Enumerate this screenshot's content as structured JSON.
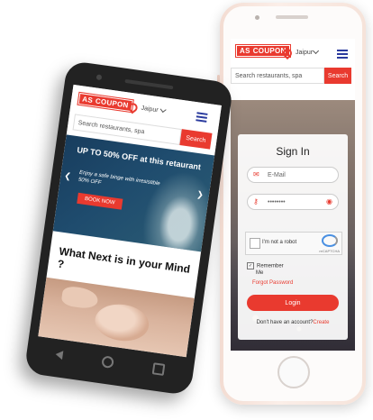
{
  "brand": {
    "logo_prefix": "AS",
    "logo_text": "COUPON",
    "accent": "#e93a2f",
    "nav_color": "#2a3b9e"
  },
  "iphone": {
    "header": {
      "city": "Jaipur",
      "search_placeholder": "Search restaurants, spa",
      "search_button": "Search"
    },
    "signin": {
      "title": "Sign In",
      "email_placeholder": "E-Mail",
      "password_value": "••••••••",
      "captcha_label": "I'm not a robot",
      "captcha_brand": "reCAPTCHA",
      "remember_label": "Remember",
      "remember_label_2": "Me",
      "forgot_label": "Forgot Password",
      "login_button": "Login",
      "no_account_text": "Don't have an account?",
      "create_link": "Create"
    }
  },
  "android": {
    "header": {
      "city": "Jaipur",
      "search_placeholder": "Search restaurants, spa",
      "search_button": "Search"
    },
    "hero": {
      "title": "UP TO 50% OFF at this retaurant",
      "subtitle": "Enjoy a safe binge with irresistible 50% OFF",
      "cta": "BOOK NOW"
    },
    "section_title": "What Next is in your Mind ?"
  },
  "icons": {
    "location": "location-pin-icon",
    "menu": "hamburger-menu-icon",
    "email": "envelope-icon",
    "password": "key-icon",
    "show_password": "eye-icon"
  }
}
